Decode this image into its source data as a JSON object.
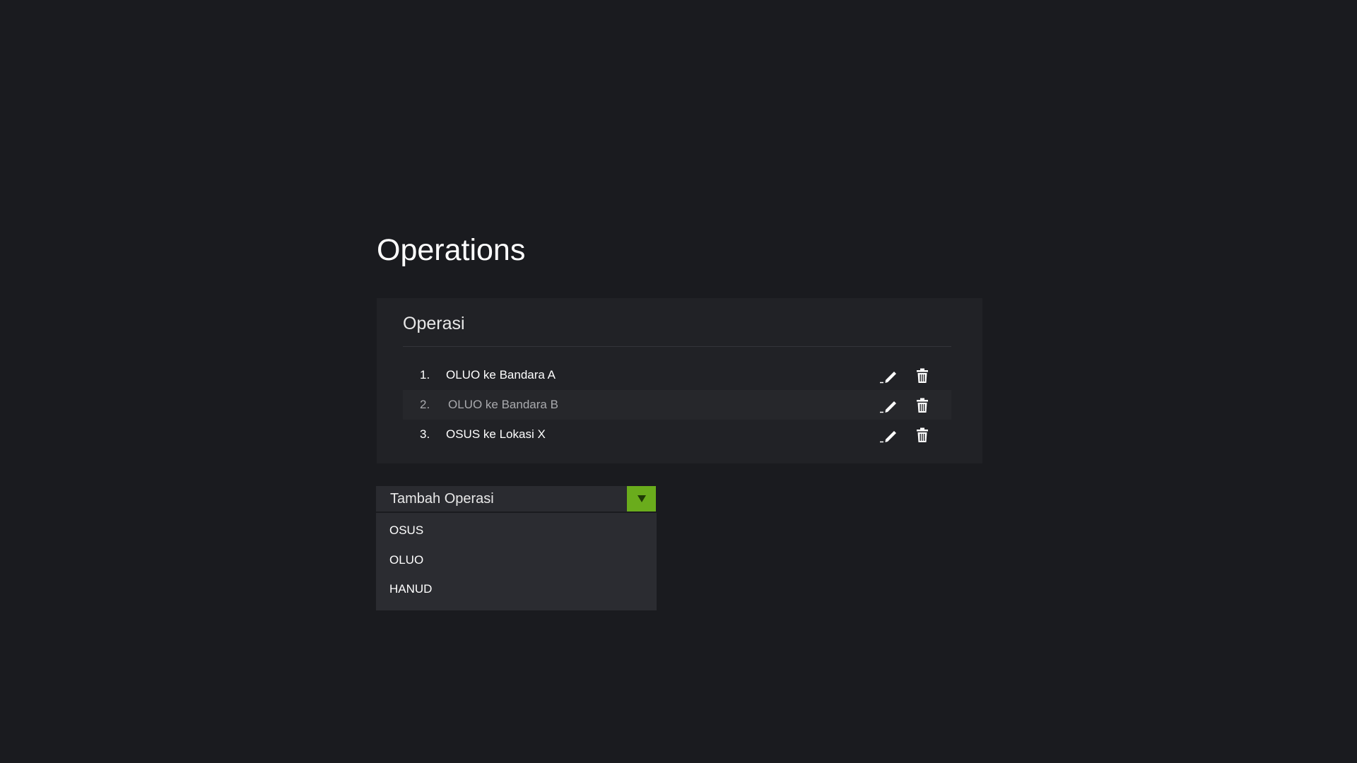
{
  "page": {
    "title": "Operations"
  },
  "panel": {
    "title": "Operasi",
    "operations": [
      {
        "number": "1.",
        "label": "OLUO ke Bandara A"
      },
      {
        "number": "2.",
        "label": "OLUO ke Bandara B"
      },
      {
        "number": "3.",
        "label": "OSUS ke Lokasi X"
      }
    ],
    "edit_icon": "pencil-icon",
    "delete_icon": "trash-icon"
  },
  "add_operation": {
    "label": "Tambah Operasi",
    "caret_icon": "caret-down-icon",
    "options": [
      "OSUS",
      "OLUO",
      "HANUD"
    ]
  },
  "colors": {
    "background": "#1a1b1f",
    "panel": "#212226",
    "accent": "#6aac1c"
  }
}
